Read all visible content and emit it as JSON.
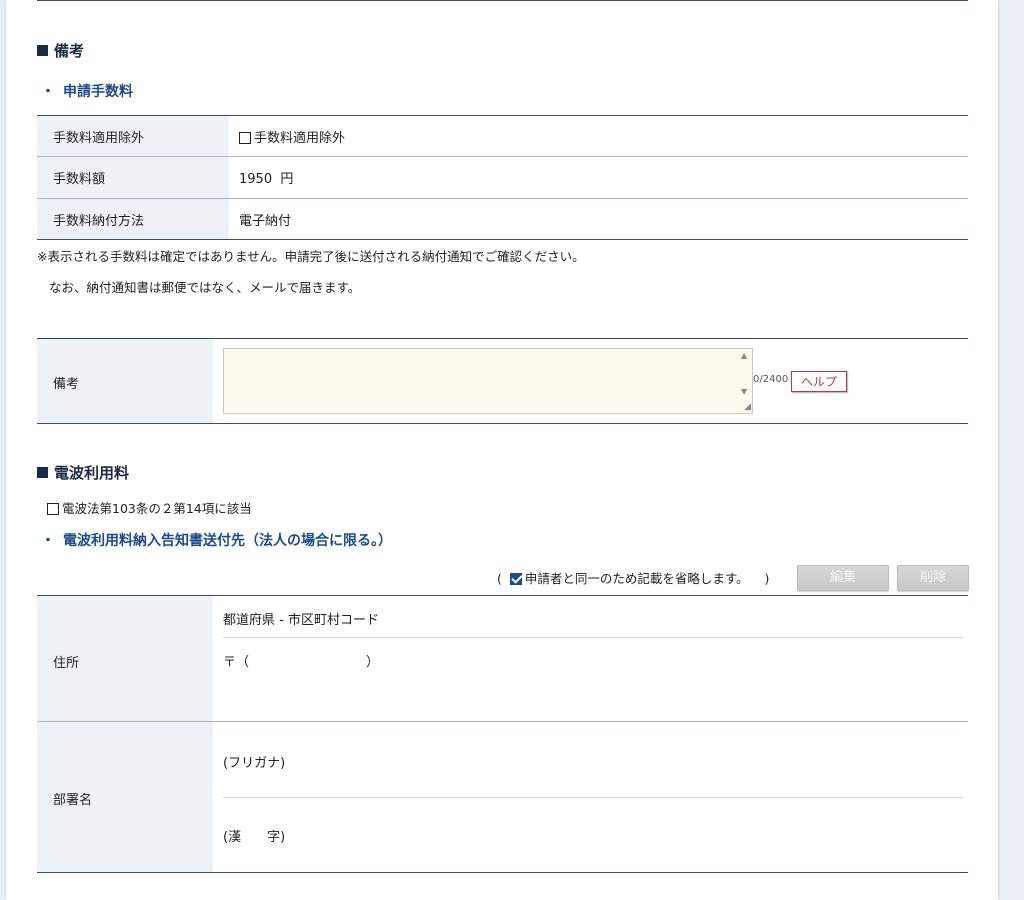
{
  "remarks": {
    "section_title": "備考",
    "fee_subtitle": "申請手数料",
    "fee_rows": [
      {
        "label": "手数料適用除外",
        "checkbox_label": "手数料適用除外"
      },
      {
        "label": "手数料額",
        "value": "1950",
        "unit": "円"
      },
      {
        "label": "手数料納付方法",
        "value": "電子納付"
      }
    ],
    "note_1": "※表示される手数料は確定ではありません。申請完了後に送付される納付通知でご確認ください。",
    "note_2": "なお、納付通知書は郵便ではなく、メールで届きます。",
    "remarks_label": "備考",
    "remarks_value": "",
    "char_count": "0/2400",
    "help_label": "ヘルプ"
  },
  "radio_fee": {
    "section_title": "電波利用料",
    "law_checkbox_label": "電波法第103条の２第14項に該当",
    "subtitle": "電波利用料納入告知書送付先（法人の場合に限る。）",
    "open_paren": "(",
    "omit_label": "申請者と同一のため記載を省略します。",
    "close_paren": ")",
    "edit_label": "編集",
    "delete_label": "削除",
    "address_label": "住所",
    "pref_city_code": "都道府県 - 市区町村コード",
    "postal": "〒（　　　　　　　　　）",
    "dept_label": "部署名",
    "furigana": "(フリガナ)",
    "kanji": "(漢　　字)"
  },
  "colors": {
    "accent": "#1f4b8a",
    "rule": "#35506d",
    "header_bg": "#eef2f7",
    "textarea_bg": "#fcfaee",
    "help_red": "#b83848"
  }
}
